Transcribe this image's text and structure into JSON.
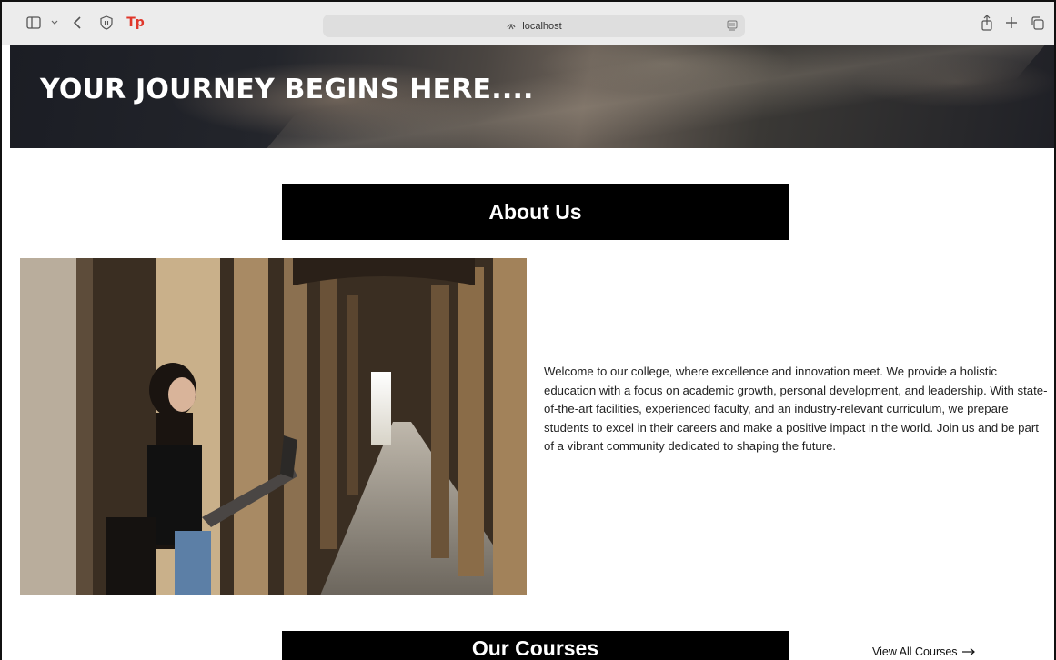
{
  "browser": {
    "address": "localhost",
    "icons": {
      "sidebar": "sidebar-icon",
      "chevron": "chevron-down-icon",
      "back": "back-icon",
      "shield": "privacy-shield-icon",
      "extension": "tp-extension-icon",
      "extension_text": "Tp",
      "site": "site-icon",
      "reader": "reader-icon",
      "share": "share-icon",
      "new_tab": "plus-icon",
      "tabs": "tabs-overview-icon"
    },
    "extension_color": "#e0372b"
  },
  "hero": {
    "title": "YOUR JOURNEY BEGINS HERE...."
  },
  "about": {
    "heading": "About Us",
    "text": "Welcome to our college, where excellence and innovation meet. We provide a holistic education with a focus on academic growth, personal development, and leadership. With state-of-the-art facilities, experienced faculty, and an industry-relevant curriculum, we prepare students to excel in their careers and make a positive impact in the world. Join us and be part of a vibrant community dedicated to shaping the future."
  },
  "courses": {
    "heading": "Our Courses",
    "view_all": "View All Courses",
    "arrow_icon": "arrow-right-icon"
  },
  "colors": {
    "section_bar": "#000000",
    "hero_text": "#ffffff",
    "body_text": "#222222"
  }
}
